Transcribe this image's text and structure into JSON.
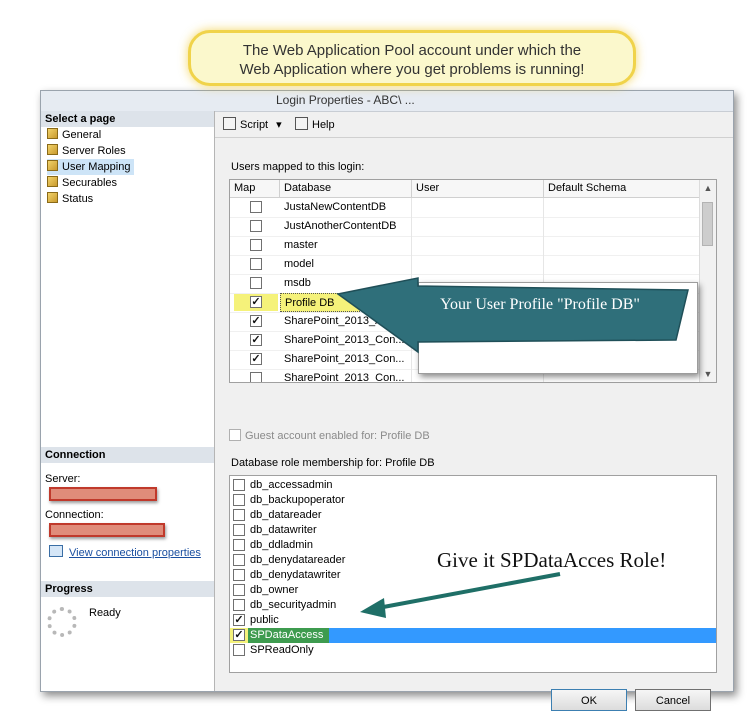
{
  "window_title": "Login Properties - ABC\\ ... ",
  "left_pane": {
    "select_page_title": "Select a page",
    "pages": [
      {
        "label": "General",
        "icon": "page-icon"
      },
      {
        "label": "Server Roles",
        "icon": "page-icon"
      },
      {
        "label": "User Mapping",
        "icon": "page-icon"
      },
      {
        "label": "Securables",
        "icon": "page-icon"
      },
      {
        "label": "Status",
        "icon": "page-icon"
      }
    ],
    "connection_title": "Connection",
    "server_label": "Server:",
    "connection_label": "Connection:",
    "view_connection_link": "View connection properties",
    "progress_title": "Progress",
    "progress_status": "Ready"
  },
  "toolbar": {
    "script_label": "Script",
    "help_label": "Help"
  },
  "users_mapped": {
    "caption": "Users mapped to this login:",
    "columns": [
      "Map",
      "Database",
      "User",
      "Default Schema"
    ],
    "rows": [
      {
        "checked": false,
        "database": "JustaNewContentDB",
        "user": "",
        "schema": ""
      },
      {
        "checked": false,
        "database": "JustAnotherContentDB",
        "user": "",
        "schema": ""
      },
      {
        "checked": false,
        "database": "master",
        "user": "",
        "schema": ""
      },
      {
        "checked": false,
        "database": "model",
        "user": "",
        "schema": ""
      },
      {
        "checked": false,
        "database": "msdb",
        "user": "",
        "schema": ""
      },
      {
        "checked": true,
        "database": "Profile DB",
        "user": "",
        "schema": ""
      },
      {
        "checked": true,
        "database": "SharePoint_2013_App...",
        "user": "",
        "schema": ""
      },
      {
        "checked": true,
        "database": "SharePoint_2013_Con...",
        "user": "",
        "schema": ""
      },
      {
        "checked": true,
        "database": "SharePoint_2013_Con...",
        "user": "",
        "schema": ""
      },
      {
        "checked": false,
        "database": "SharePoint_2013_Con...",
        "user": "",
        "schema": ""
      }
    ]
  },
  "guest_account": {
    "label": "Guest account enabled for: Profile DB",
    "checked": false,
    "enabled": false
  },
  "role_membership": {
    "caption": "Database role membership for: Profile DB",
    "roles": [
      {
        "label": "db_accessadmin",
        "checked": false
      },
      {
        "label": "db_backupoperator",
        "checked": false
      },
      {
        "label": "db_datareader",
        "checked": false
      },
      {
        "label": "db_datawriter",
        "checked": false
      },
      {
        "label": "db_ddladmin",
        "checked": false
      },
      {
        "label": "db_denydatareader",
        "checked": false
      },
      {
        "label": "db_denydatawriter",
        "checked": false
      },
      {
        "label": "db_owner",
        "checked": false
      },
      {
        "label": "db_securityadmin",
        "checked": false
      },
      {
        "label": "public",
        "checked": true
      },
      {
        "label": "SPDataAccess",
        "checked": true,
        "selected": true
      },
      {
        "label": "SPReadOnly",
        "checked": false
      }
    ]
  },
  "buttons": {
    "ok": "OK",
    "cancel": "Cancel"
  },
  "annotations": {
    "top_callout_line1": "The Web Application Pool account under which the",
    "top_callout_line2": "Web Application where you get problems is running!",
    "profile_arrow_text": "Your User Profile \"Profile DB\"",
    "role_arrow_text": "Give it SPDataAcces Role!"
  },
  "colors": {
    "highlight_yellow": "#f5f27a",
    "selection_blue": "#3399ff",
    "role_green": "#3e9b4f",
    "arrow_teal": "#2f6f7a",
    "callout_fill": "#fbf8cc",
    "callout_border": "#f0d34a",
    "redaction": "#c0392b"
  }
}
